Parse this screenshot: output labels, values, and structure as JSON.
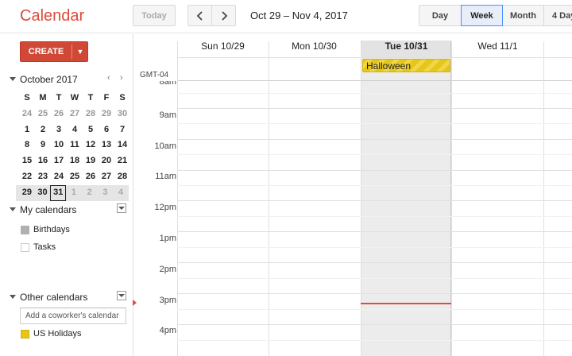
{
  "app": {
    "title": "Calendar"
  },
  "toolbar": {
    "today_label": "Today",
    "prev_icon": "chevron-left-icon",
    "next_icon": "chevron-right-icon",
    "date_range": "Oct 29 – Nov 4, 2017",
    "views": {
      "day": "Day",
      "week": "Week",
      "month": "Month",
      "four_day": "4 Day"
    },
    "selected_view": "Week"
  },
  "sidebar": {
    "create_label": "CREATE",
    "mini_calendar": {
      "title": "October 2017",
      "weekday_headers": [
        "S",
        "M",
        "T",
        "W",
        "T",
        "F",
        "S"
      ],
      "weeks": [
        [
          "24",
          "25",
          "26",
          "27",
          "28",
          "29",
          "30"
        ],
        [
          "1",
          "2",
          "3",
          "4",
          "5",
          "6",
          "7"
        ],
        [
          "8",
          "9",
          "10",
          "11",
          "12",
          "13",
          "14"
        ],
        [
          "15",
          "16",
          "17",
          "18",
          "19",
          "20",
          "21"
        ],
        [
          "22",
          "23",
          "24",
          "25",
          "26",
          "27",
          "28"
        ],
        [
          "29",
          "30",
          "31",
          "1",
          "2",
          "3",
          "4"
        ]
      ],
      "today": "31"
    },
    "my_calendars": {
      "title": "My calendars",
      "items": [
        {
          "label": "Birthdays",
          "color": "#b0b0b0"
        },
        {
          "label": "Tasks",
          "color": "#ffffff"
        }
      ]
    },
    "other_calendars": {
      "title": "Other calendars",
      "add_placeholder": "Add a coworker's calendar",
      "items": [
        {
          "label": "US Holidays",
          "color": "#e6c619"
        }
      ]
    }
  },
  "grid": {
    "timezone": "GMT-04",
    "columns": [
      "Sun 10/29",
      "Mon 10/30",
      "Tue 10/31",
      "Wed 11/1"
    ],
    "today_column": "Tue 10/31",
    "all_day_events": [
      {
        "title": "Halloween",
        "day": "Tue 10/31",
        "color": "#e6c619"
      }
    ],
    "hours": [
      "8am",
      "9am",
      "10am",
      "11am",
      "12pm",
      "1pm",
      "2pm",
      "3pm",
      "4pm"
    ]
  }
}
